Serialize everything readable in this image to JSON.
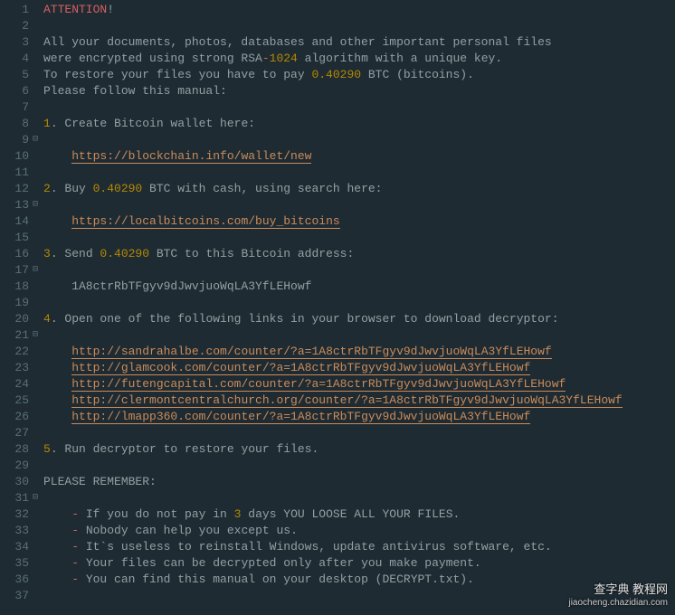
{
  "lines": [
    {
      "n": 1,
      "fold": false,
      "segs": [
        {
          "t": "ATTENTION",
          "c": "kw-red"
        },
        {
          "t": "!"
        }
      ]
    },
    {
      "n": 2,
      "fold": false,
      "segs": []
    },
    {
      "n": 3,
      "fold": false,
      "segs": [
        {
          "t": "All your documents, photos, databases and other important personal files"
        }
      ]
    },
    {
      "n": 4,
      "fold": false,
      "segs": [
        {
          "t": "were encrypted using strong RSA"
        },
        {
          "t": "-",
          "c": "kw-red"
        },
        {
          "t": "1024",
          "c": "kw-yellow"
        },
        {
          "t": " algorithm with a unique key."
        }
      ]
    },
    {
      "n": 5,
      "fold": false,
      "segs": [
        {
          "t": "To restore your files you have to pay "
        },
        {
          "t": "0.40290",
          "c": "kw-yellow"
        },
        {
          "t": " BTC (bitcoins)."
        }
      ]
    },
    {
      "n": 6,
      "fold": false,
      "segs": [
        {
          "t": "Please follow this manual:"
        }
      ]
    },
    {
      "n": 7,
      "fold": false,
      "segs": []
    },
    {
      "n": 8,
      "fold": false,
      "segs": [
        {
          "t": "1",
          "c": "kw-yellow"
        },
        {
          "t": ". Create Bitcoin wallet here:"
        }
      ]
    },
    {
      "n": 9,
      "fold": true,
      "segs": []
    },
    {
      "n": 10,
      "fold": false,
      "segs": [
        {
          "t": "    "
        },
        {
          "t": "https://blockchain.info/wallet/new",
          "c": "kw-link"
        }
      ]
    },
    {
      "n": 11,
      "fold": false,
      "segs": []
    },
    {
      "n": 12,
      "fold": false,
      "segs": [
        {
          "t": "2",
          "c": "kw-yellow"
        },
        {
          "t": ". Buy "
        },
        {
          "t": "0.40290",
          "c": "kw-yellow"
        },
        {
          "t": " BTC with cash, using search here:"
        }
      ]
    },
    {
      "n": 13,
      "fold": true,
      "segs": []
    },
    {
      "n": 14,
      "fold": false,
      "segs": [
        {
          "t": "    "
        },
        {
          "t": "https://localbitcoins.com/buy_bitcoins",
          "c": "kw-link"
        }
      ]
    },
    {
      "n": 15,
      "fold": false,
      "segs": []
    },
    {
      "n": 16,
      "fold": false,
      "segs": [
        {
          "t": "3",
          "c": "kw-yellow"
        },
        {
          "t": ". Send "
        },
        {
          "t": "0.40290",
          "c": "kw-yellow"
        },
        {
          "t": " BTC to this Bitcoin address:"
        }
      ]
    },
    {
      "n": 17,
      "fold": true,
      "segs": []
    },
    {
      "n": 18,
      "fold": false,
      "segs": [
        {
          "t": "    1A8ctrRbTFgyv9dJwvjuoWqLA3YfLEHowf"
        }
      ]
    },
    {
      "n": 19,
      "fold": false,
      "segs": []
    },
    {
      "n": 20,
      "fold": false,
      "segs": [
        {
          "t": "4",
          "c": "kw-yellow"
        },
        {
          "t": ". Open one of the following links in your browser to download decryptor:"
        }
      ]
    },
    {
      "n": 21,
      "fold": true,
      "segs": []
    },
    {
      "n": 22,
      "fold": false,
      "segs": [
        {
          "t": "    "
        },
        {
          "t": "http://sandrahalbe.com/counter/?a=1A8ctrRbTFgyv9dJwvjuoWqLA3YfLEHowf",
          "c": "kw-link"
        }
      ]
    },
    {
      "n": 23,
      "fold": false,
      "segs": [
        {
          "t": "    "
        },
        {
          "t": "http://glamcook.com/counter/?a=1A8ctrRbTFgyv9dJwvjuoWqLA3YfLEHowf",
          "c": "kw-link"
        }
      ]
    },
    {
      "n": 24,
      "fold": false,
      "segs": [
        {
          "t": "    "
        },
        {
          "t": "http://futengcapital.com/counter/?a=1A8ctrRbTFgyv9dJwvjuoWqLA3YfLEHowf",
          "c": "kw-link"
        }
      ]
    },
    {
      "n": 25,
      "fold": false,
      "segs": [
        {
          "t": "    "
        },
        {
          "t": "http://clermontcentralchurch.org/counter/?a=1A8ctrRbTFgyv9dJwvjuoWqLA3YfLEHowf",
          "c": "kw-link"
        }
      ]
    },
    {
      "n": 26,
      "fold": false,
      "segs": [
        {
          "t": "    "
        },
        {
          "t": "http://lmapp360.com/counter/?a=1A8ctrRbTFgyv9dJwvjuoWqLA3YfLEHowf",
          "c": "kw-link"
        }
      ]
    },
    {
      "n": 27,
      "fold": false,
      "segs": []
    },
    {
      "n": 28,
      "fold": false,
      "segs": [
        {
          "t": "5",
          "c": "kw-yellow"
        },
        {
          "t": ". Run decryptor to restore your files."
        }
      ]
    },
    {
      "n": 29,
      "fold": false,
      "segs": []
    },
    {
      "n": 30,
      "fold": false,
      "segs": [
        {
          "t": "PLEASE REMEMBER:"
        }
      ]
    },
    {
      "n": 31,
      "fold": true,
      "segs": []
    },
    {
      "n": 32,
      "fold": false,
      "segs": [
        {
          "t": "    "
        },
        {
          "t": "-",
          "c": "kw-red"
        },
        {
          "t": " If you do not pay in "
        },
        {
          "t": "3",
          "c": "kw-yellow"
        },
        {
          "t": " days YOU LOOSE ALL YOUR FILES."
        }
      ]
    },
    {
      "n": 33,
      "fold": false,
      "segs": [
        {
          "t": "    "
        },
        {
          "t": "-",
          "c": "kw-red"
        },
        {
          "t": " Nobody can help you except us."
        }
      ]
    },
    {
      "n": 34,
      "fold": false,
      "segs": [
        {
          "t": "    "
        },
        {
          "t": "-",
          "c": "kw-red"
        },
        {
          "t": " It`s useless to reinstall Windows, update antivirus software, etc."
        }
      ]
    },
    {
      "n": 35,
      "fold": false,
      "segs": [
        {
          "t": "    "
        },
        {
          "t": "-",
          "c": "kw-red"
        },
        {
          "t": " Your files can be decrypted only after you make payment."
        }
      ]
    },
    {
      "n": 36,
      "fold": false,
      "segs": [
        {
          "t": "    "
        },
        {
          "t": "-",
          "c": "kw-red"
        },
        {
          "t": " You can find this manual on your desktop (DECRYPT.txt)."
        }
      ]
    },
    {
      "n": 37,
      "fold": false,
      "segs": []
    }
  ],
  "watermark": {
    "top": "查字典 教程网",
    "bottom": "jiaocheng.chazidian.com"
  }
}
